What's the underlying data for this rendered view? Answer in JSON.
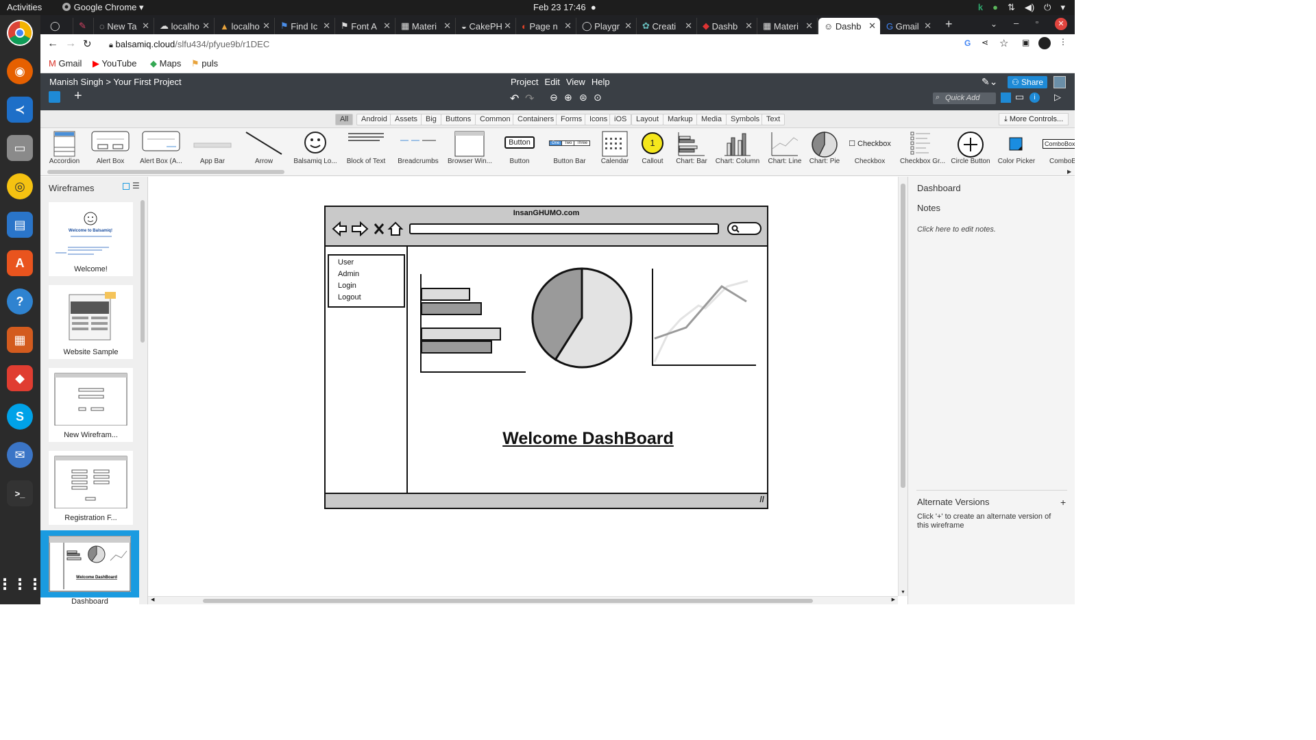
{
  "os_bar": {
    "activities": "Activities",
    "app_name": "Google Chrome",
    "datetime": "Feb 23  17:46"
  },
  "tabs": [
    {
      "label": "",
      "icon": "github-icon"
    },
    {
      "label": "",
      "icon": "cake-icon"
    },
    {
      "label": "New Ta",
      "icon": "tab-icon"
    },
    {
      "label": "localho",
      "icon": "cloud-icon"
    },
    {
      "label": "localho",
      "icon": "flame-icon"
    },
    {
      "label": "Find Ic",
      "icon": "flag-icon"
    },
    {
      "label": "Font A",
      "icon": "flag-icon"
    },
    {
      "label": "Materi",
      "icon": "grid-icon"
    },
    {
      "label": "CakePH",
      "icon": "cake-icon"
    },
    {
      "label": "Page n",
      "icon": "gitlab-icon"
    },
    {
      "label": "Playgr",
      "icon": "github-icon"
    },
    {
      "label": "Creati",
      "icon": "openai-icon"
    },
    {
      "label": "Dashb",
      "icon": "dashboard-icon"
    },
    {
      "label": "Materi",
      "icon": "grid-icon"
    },
    {
      "label": "Dashb",
      "icon": "smiley-icon",
      "active": true
    },
    {
      "label": "Gmail",
      "icon": "google-icon"
    }
  ],
  "address": {
    "host": "balsamiq.cloud",
    "path": "/slfu434/pfyue9b/r1DEC"
  },
  "bookmarks": [
    "Gmail",
    "YouTube",
    "Maps",
    "puls"
  ],
  "app": {
    "user": "Manish Singh",
    "separator": ">",
    "project": "Your First Project",
    "menus": [
      "Project",
      "Edit",
      "View",
      "Help"
    ],
    "share_label": "Share",
    "quick_add_placeholder": "Quick Add"
  },
  "categories": [
    "All",
    "Android",
    "Assets",
    "Big",
    "Buttons",
    "Common",
    "Containers",
    "Forms",
    "Icons",
    "iOS",
    "Layout",
    "Markup",
    "Media",
    "Symbols",
    "Text"
  ],
  "selected_category": "All",
  "more_controls": "More Controls...",
  "controls": [
    "Accordion",
    "Alert Box",
    "Alert Box (A...",
    "App Bar",
    "Arrow",
    "Balsamiq Lo...",
    "Block of Text",
    "Breadcrumbs",
    "Browser Win...",
    "Button",
    "Button Bar",
    "Calendar",
    "Callout",
    "Chart: Bar",
    "Chart: Column",
    "Chart: Line",
    "Chart: Pie",
    "Checkbox",
    "Checkbox Gr...",
    "Circle Button",
    "Color Picker",
    "ComboBo"
  ],
  "control_texts": {
    "button": "Button",
    "checkbox": "Checkbox",
    "combobox": "ComboBox",
    "callout": "1",
    "button_bar": [
      "One",
      "Two",
      "Three"
    ]
  },
  "wireframes_panel": {
    "title": "Wireframes",
    "items": [
      {
        "label": "Welcome!"
      },
      {
        "label": "Website Sample"
      },
      {
        "label": "New Wirefram..."
      },
      {
        "label": "Registration F..."
      },
      {
        "label": "Dashboard",
        "selected": true
      }
    ],
    "thumb_texts": {
      "welcome_heading": "Welcome to Balsamiq!",
      "dashboard_heading": "Welcome DashBoard"
    }
  },
  "mockup": {
    "title": "InsanGHUMO.com",
    "menu_items": [
      "User",
      "Admin",
      "Login",
      "Logout"
    ],
    "heading": "Welcome DashBoard",
    "pie_slices": [
      0.41,
      0.59
    ],
    "bar_values": [
      0.55,
      0.68,
      0.9,
      0.8
    ]
  },
  "right_panel": {
    "title": "Dashboard",
    "notes_label": "Notes",
    "notes_hint": "Click here to edit notes.",
    "alt_title": "Alternate Versions",
    "alt_plus": "+",
    "alt_desc": "Click '+' to create an alternate version of this wireframe"
  },
  "colors": {
    "app_header": "#3a3f45",
    "accent": "#1a9be0",
    "mock_fill": "#c9c9c9"
  }
}
